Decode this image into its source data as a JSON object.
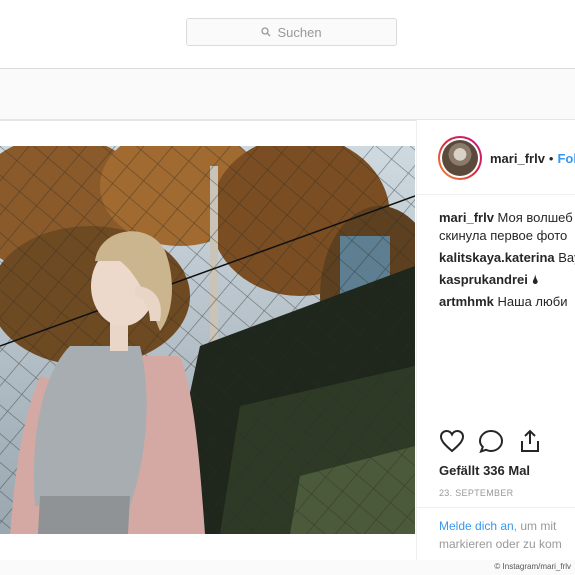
{
  "search": {
    "placeholder": "Suchen"
  },
  "post": {
    "username": "mari_frlv",
    "follow_label": "Fol",
    "separator": "•",
    "comments": [
      {
        "user": "mari_frlv",
        "text": "Моя волшеб",
        "continuation": "скинула первое фото"
      },
      {
        "user": "kalitskaya.katerina",
        "text": "Bay"
      },
      {
        "user": "kasprukandrei",
        "text": "🌢"
      },
      {
        "user": "artmhmk",
        "text": "Наша люби"
      }
    ],
    "likes": "Gefällt 336 Mal",
    "date": "23. SEPTEMBER",
    "login_link": "Melde dich an",
    "login_text": ", um mit",
    "login_text2": "markieren oder zu kom"
  },
  "credit": "© Instagram/mari_frlv",
  "icons": [
    "search-icon",
    "heart-icon",
    "comment-icon",
    "share-icon"
  ],
  "colors": {
    "link": "#3897f0",
    "border": "#dbdbdb",
    "muted": "#999999"
  }
}
